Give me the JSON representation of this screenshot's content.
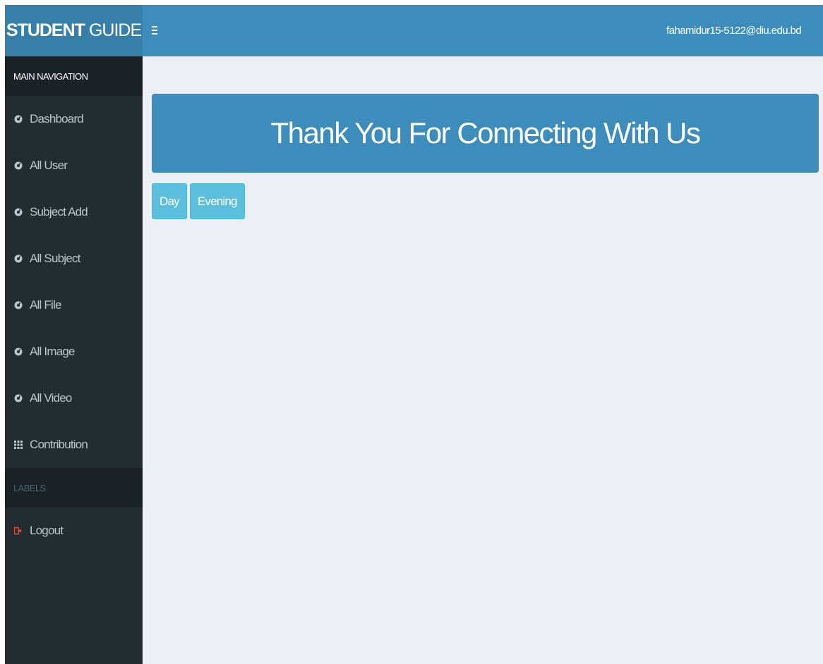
{
  "header": {
    "brand_bold": "STUDENT",
    "brand_light": "GUIDE",
    "user_email": "fahamidur15-5122@diu.edu.bd"
  },
  "sidebar": {
    "main_nav_title": "MAIN NAVIGATION",
    "items": [
      {
        "label": "Dashboard",
        "icon": "dashboard-icon"
      },
      {
        "label": "All User",
        "icon": "dashboard-icon"
      },
      {
        "label": "Subject Add",
        "icon": "dashboard-icon"
      },
      {
        "label": "All Subject",
        "icon": "dashboard-icon"
      },
      {
        "label": "All File",
        "icon": "dashboard-icon"
      },
      {
        "label": "All Image",
        "icon": "dashboard-icon"
      },
      {
        "label": "All Video",
        "icon": "dashboard-icon"
      },
      {
        "label": "Contribution",
        "icon": "grid-icon"
      }
    ],
    "labels_title": "LABELS",
    "logout_label": "Logout"
  },
  "main": {
    "banner_text": "Thank You For Connecting With Us",
    "buttons": {
      "day": "Day",
      "evening": "Evening"
    }
  },
  "colors": {
    "header": "#3c8dbc",
    "brand": "#367fa9",
    "sidebar": "#222d32",
    "sidebar_header": "#1a2226",
    "content_bg": "#ecf0f5",
    "info_button": "#5bc0de",
    "logout_icon": "#dd4b39"
  }
}
